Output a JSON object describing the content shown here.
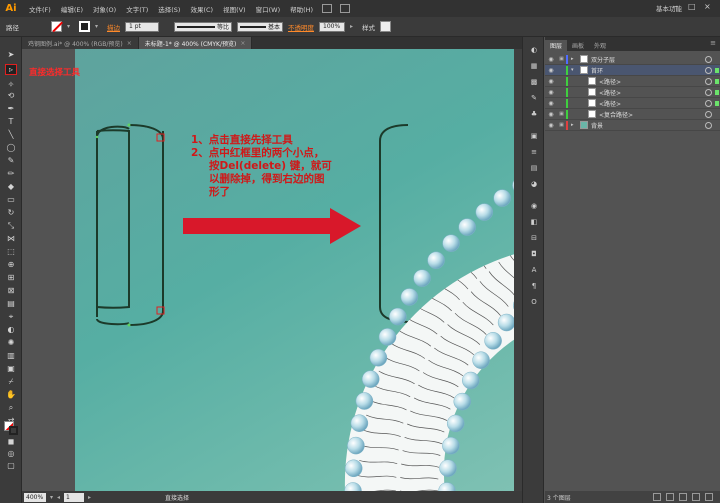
{
  "app": {
    "logo": "Ai",
    "menus": [
      "文件(F)",
      "编辑(E)",
      "对象(O)",
      "文字(T)",
      "选择(S)",
      "效果(C)",
      "视图(V)",
      "窗口(W)",
      "帮助(H)"
    ],
    "workspace": "基本功能",
    "window_controls": [
      "−",
      "□",
      "×"
    ]
  },
  "control_bar": {
    "selection_label": "路径",
    "stroke_label": "描边",
    "stroke_weight": "1 pt",
    "profile_label": "等比",
    "brush_label": "基本",
    "opacity_label": "不透明度",
    "opacity_value": "100%",
    "style_label": "样式"
  },
  "tabs": [
    {
      "label": "鸡钢图例.ai* @ 400% (RGB/预览)",
      "active": false
    },
    {
      "label": "未标题-1* @ 400% (CMYK/预览)",
      "active": true
    }
  ],
  "canvas": {
    "tool_annotation": "直接选择工具",
    "instructions": [
      "1、点击直接先择工具",
      "2、点中红框里的两个小点，",
      "按Del(delete) 键，就可",
      "以删除掉，得到右边的图",
      "形了"
    ],
    "colors": {
      "annotation": "#ff2a2a",
      "arrow": "#d8182a",
      "artboard": "#5fa39e",
      "path": "#1c3a2a"
    }
  },
  "statusbar": {
    "zoom": "400%",
    "page": "1",
    "status": "直接选择"
  },
  "layers_panel": {
    "tabs": [
      "图层",
      "画板",
      "外观"
    ],
    "rows": [
      {
        "name": "双分子层",
        "level": 0,
        "expanded": false,
        "locked": true,
        "color": "#4f6cff"
      },
      {
        "name": "首环",
        "level": 0,
        "expanded": true,
        "locked": false,
        "color": "#3fcf3f",
        "selected": true
      },
      {
        "name": "<路径>",
        "level": 1,
        "color": "#3fcf3f"
      },
      {
        "name": "<路径>",
        "level": 1,
        "color": "#3fcf3f"
      },
      {
        "name": "<路径>",
        "level": 1,
        "color": "#3fcf3f"
      },
      {
        "name": "<复合路径>",
        "level": 1,
        "color": "#3fcf3f",
        "locked": true
      },
      {
        "name": "背景",
        "level": 0,
        "expanded": false,
        "locked": true,
        "color": "#e04040"
      }
    ],
    "footer": "3 个图层"
  }
}
